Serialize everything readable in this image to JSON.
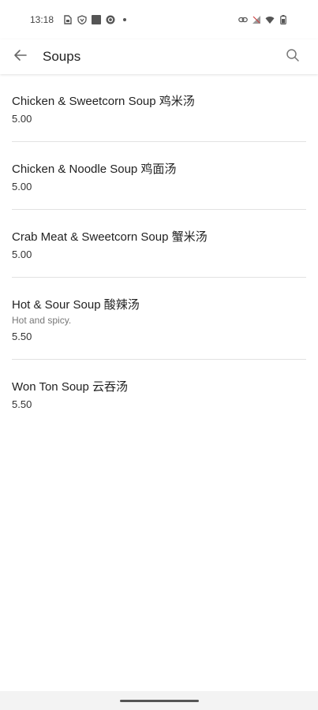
{
  "status_bar": {
    "time": "13:18",
    "left_icons": [
      "sim-icon",
      "shield-icon",
      "square-icon",
      "sync-icon",
      "dot-icon"
    ],
    "right_icons": [
      "link-icon",
      "no-sim-icon",
      "wifi-icon",
      "battery-icon"
    ]
  },
  "app_bar": {
    "title": "Soups",
    "back_icon": "arrow-back-icon",
    "search_icon": "search-icon"
  },
  "menu": {
    "items": [
      {
        "name": "Chicken & Sweetcorn Soup 鸡米汤",
        "description": "",
        "price": "5.00"
      },
      {
        "name": "Chicken & Noodle Soup 鸡面汤",
        "description": "",
        "price": "5.00"
      },
      {
        "name": "Crab Meat & Sweetcorn Soup 蟹米汤",
        "description": "",
        "price": "5.00"
      },
      {
        "name": "Hot & Sour Soup 酸辣汤",
        "description": "Hot and spicy.",
        "price": "5.50"
      },
      {
        "name": "Won Ton Soup 云吞汤",
        "description": "",
        "price": "5.50"
      }
    ]
  },
  "colors": {
    "text_primary": "#222222",
    "text_secondary": "#777777",
    "divider": "#e2e2e2",
    "background": "#ffffff"
  }
}
